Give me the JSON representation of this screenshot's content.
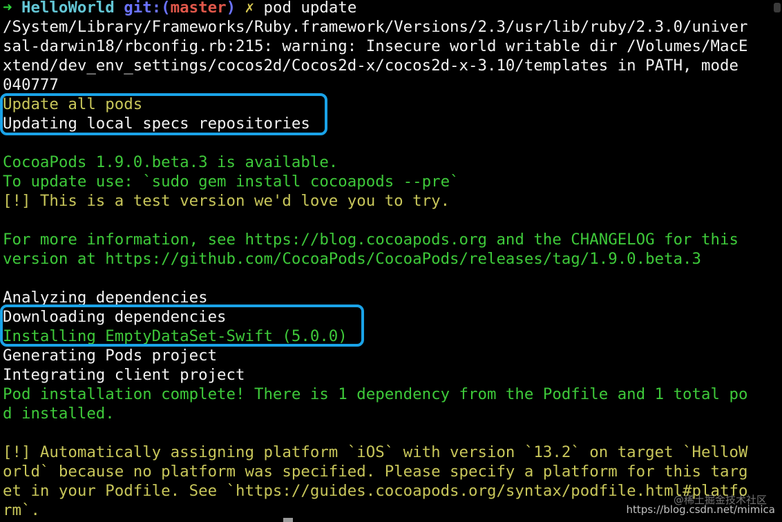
{
  "prompt": {
    "arrow": "➜",
    "directory": "HelloWorld",
    "git_prefix": "git:(",
    "branch": "master",
    "git_suffix": ")",
    "dirty_mark": "✗",
    "command": "pod update"
  },
  "output": [
    {
      "text": "/System/Library/Frameworks/Ruby.framework/Versions/2.3/usr/lib/ruby/2.3.0/univer",
      "color": "white"
    },
    {
      "text": "sal-darwin18/rbconfig.rb:215: warning: Insecure world writable dir /Volumes/MacE",
      "color": "white"
    },
    {
      "text": "xtend/dev_env_settings/cocos2d/Cocos2d-x/cocos2d-x-3.10/templates in PATH, mode",
      "color": "white"
    },
    {
      "text": "040777",
      "color": "white"
    },
    {
      "text": "Update all pods",
      "color": "yellow"
    },
    {
      "text": "Updating local specs repositories",
      "color": "white"
    },
    {
      "text": "",
      "color": "white"
    },
    {
      "text": "CocoaPods 1.9.0.beta.3 is available.",
      "color": "green"
    },
    {
      "text": "To update use: `sudo gem install cocoapods --pre`",
      "color": "green"
    },
    {
      "text": "[!] This is a test version we'd love you to try.",
      "color": "yellow"
    },
    {
      "text": "",
      "color": "white"
    },
    {
      "text": "For more information, see https://blog.cocoapods.org and the CHANGELOG for this",
      "color": "green"
    },
    {
      "text": "version at https://github.com/CocoaPods/CocoaPods/releases/tag/1.9.0.beta.3",
      "color": "green"
    },
    {
      "text": "",
      "color": "white"
    },
    {
      "text": "Analyzing dependencies",
      "color": "white"
    },
    {
      "text": "Downloading dependencies",
      "color": "white"
    },
    {
      "text": "Installing EmptyDataSet-Swift (5.0.0)",
      "color": "green"
    },
    {
      "text": "Generating Pods project",
      "color": "white"
    },
    {
      "text": "Integrating client project",
      "color": "white"
    },
    {
      "text": "Pod installation complete! There is 1 dependency from the Podfile and 1 total po",
      "color": "green"
    },
    {
      "text": "d installed.",
      "color": "green"
    },
    {
      "text": "",
      "color": "white"
    },
    {
      "text": "[!] Automatically assigning platform `iOS` with version `13.2` on target `HelloW",
      "color": "yellow"
    },
    {
      "text": "orld` because no platform was specified. Please specify a platform for this targ",
      "color": "yellow"
    },
    {
      "text": "et in your Podfile. See `https://guides.cocoapods.org/syntax/podfile.html#platfo",
      "color": "yellow"
    },
    {
      "text": "rm`.",
      "color": "yellow"
    }
  ],
  "watermark": {
    "line1": "@稀土掘金技术社区",
    "line2": "https://blog.csdn.net/mimica"
  },
  "highlight_color": "#1aa3e8"
}
